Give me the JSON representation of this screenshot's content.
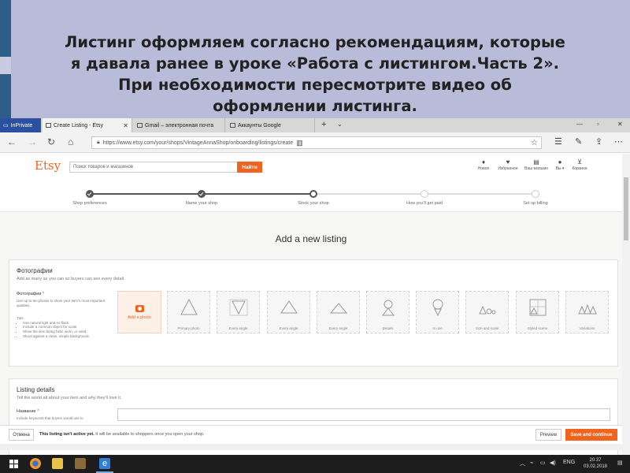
{
  "slide": {
    "title_lines": [
      "Листинг оформляем согласно рекомендациям, которые",
      "я давала ранее в уроке «Работа с листингом.Часть 2».",
      "При необходимости пересмотрите видео об",
      "оформлении листинга."
    ]
  },
  "browser": {
    "tabs": [
      {
        "label": "InPrivate"
      },
      {
        "label": "Create Listing - Etsy"
      },
      {
        "label": "Gmail – электронная почта"
      },
      {
        "label": "Аккаунты Google"
      }
    ],
    "url": "https://www.etsy.com/your/shops/VintageAnnaShop/onboarding/listings/create"
  },
  "etsy": {
    "logo": "Etsy",
    "search_placeholder": "Поиск товаров и магазинов",
    "search_button": "Найти",
    "header_items": [
      {
        "icon": "bell-icon",
        "glyph": "♦",
        "label": "Новое"
      },
      {
        "icon": "heart-icon",
        "glyph": "♥",
        "label": "Избранное"
      },
      {
        "icon": "shop-icon",
        "glyph": "▤",
        "label": "Ваш магазин"
      },
      {
        "icon": "user-icon",
        "glyph": "●",
        "label": "Вы ▾"
      },
      {
        "icon": "cart-icon",
        "glyph": "⊻",
        "label": "Корзина"
      }
    ],
    "steps": [
      {
        "label": "Shop preferences",
        "state": "done"
      },
      {
        "label": "Name your shop",
        "state": "done"
      },
      {
        "label": "Stock your shop",
        "state": "current"
      },
      {
        "label": "How you'll get paid",
        "state": "todo"
      },
      {
        "label": "Set up billing",
        "state": "todo"
      }
    ],
    "page_heading": "Add a new listing",
    "photos": {
      "title": "Фотографии",
      "subtitle": "Add as many as you can so buyers can see every detail.",
      "field_label": "Фотографии",
      "field_desc": "Use up to ten photos to show your item's most important qualities.",
      "tips_title": "Tips:",
      "tips": [
        "Use natural light and no flash.",
        "Include a common object for scale.",
        "Show the item being held, worn, or used.",
        "Shoot against a clean, simple background."
      ],
      "add_photo": "Add a photo",
      "slots": [
        {
          "label": "Primary photo",
          "shape": "triangle"
        },
        {
          "label": "Every angle",
          "shape": "triangle-down"
        },
        {
          "label": "Every angle",
          "shape": "triangle"
        },
        {
          "label": "Every angle",
          "shape": "triangle-flat"
        },
        {
          "label": "Details",
          "shape": "magnifier"
        },
        {
          "label": "In use",
          "shape": "person"
        },
        {
          "label": "Size and scale",
          "shape": "drops"
        },
        {
          "label": "Styled scene",
          "shape": "scene"
        },
        {
          "label": "Variations",
          "shape": "three"
        }
      ]
    },
    "details": {
      "title": "Listing details",
      "subtitle": "Tell the world all about your item and why they'll love it.",
      "name_label": "Название",
      "name_desc": "Include keywords that buyers would use to"
    },
    "bottom": {
      "cancel": "Отмена",
      "notice_bold": "This listing isn't active yet.",
      "notice_rest": " It will be available to shoppers once you open your shop.",
      "preview": "Preview",
      "save": "Save and continue"
    }
  },
  "taskbar": {
    "lang": "ENG",
    "time": "20:37",
    "date": "03.02.2018"
  }
}
